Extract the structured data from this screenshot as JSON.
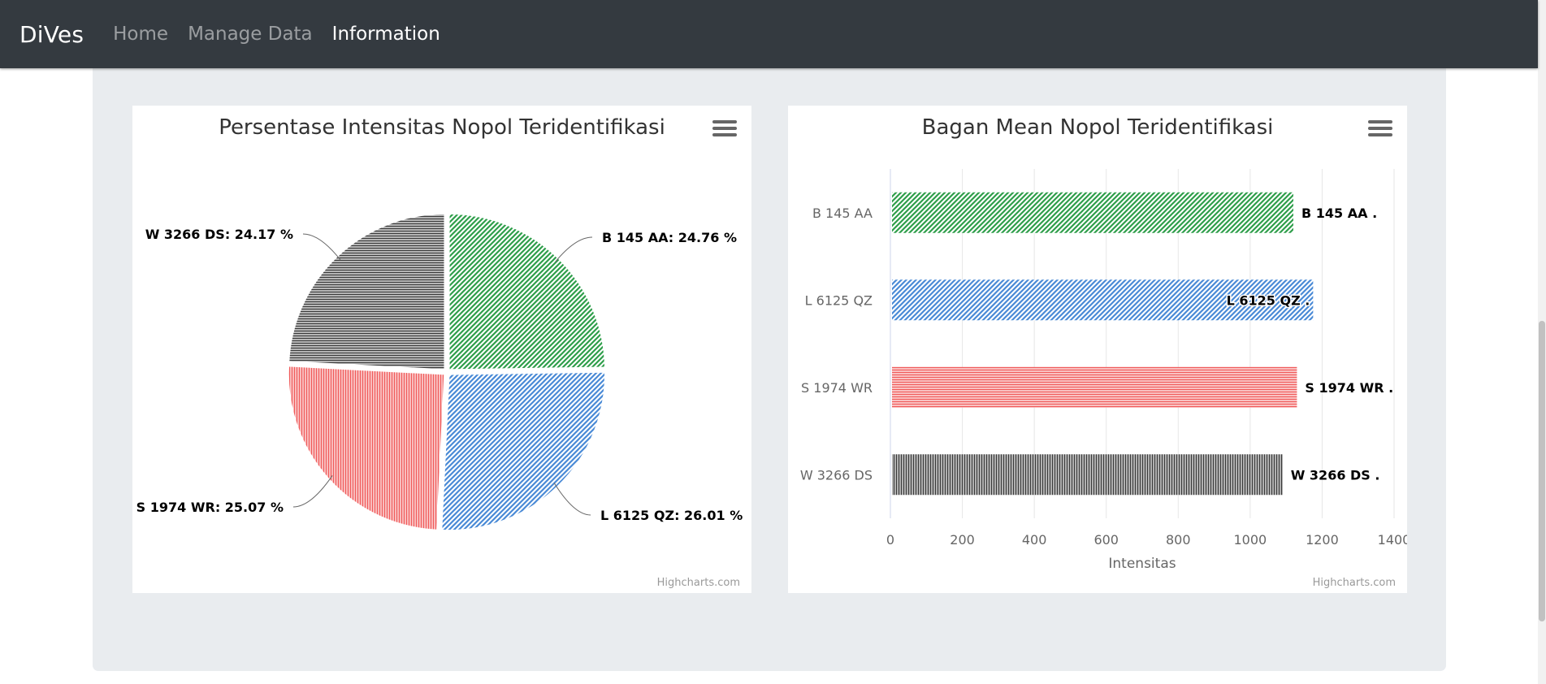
{
  "navbar": {
    "brand": "DiVes",
    "links": [
      {
        "label": "Home",
        "active": false
      },
      {
        "label": "Manage Data",
        "active": false
      },
      {
        "label": "Information",
        "active": true
      }
    ]
  },
  "credits": "Highcharts.com",
  "colors": {
    "green": "#2e9e4a",
    "blue": "#4a8ad6",
    "red": "#f05a5a",
    "black": "#3a3a3a"
  },
  "chart_data": [
    {
      "type": "pie",
      "title": "Persentase Intensitas Nopol Teridentifikasi",
      "slices": [
        {
          "name": "B 145 AA",
          "value": 24.76,
          "label": "B 145 AA: 24.76 %",
          "color": "#2e9e4a",
          "pattern": "diagonal"
        },
        {
          "name": "L 6125 QZ",
          "value": 26.01,
          "label": "L 6125 QZ: 26.01 %",
          "color": "#4a8ad6",
          "pattern": "diagonal"
        },
        {
          "name": "S 1974 WR",
          "value": 25.07,
          "label": "S 1974 WR: 25.07 %",
          "color": "#f05a5a",
          "pattern": "vertical"
        },
        {
          "name": "W 3266 DS",
          "value": 24.17,
          "label": "W 3266 DS: 24.17 %",
          "color": "#3a3a3a",
          "pattern": "horizontal"
        }
      ]
    },
    {
      "type": "bar",
      "title": "Bagan Mean Nopol Teridentifikasi",
      "categories": [
        "B 145 AA",
        "L 6125 QZ",
        "S 1974 WR",
        "W 3266 DS"
      ],
      "values": [
        1120,
        1175,
        1130,
        1090
      ],
      "data_labels": [
        "B 145 AA .",
        "L 6125 QZ .",
        "S 1974 WR .",
        "W 3266 DS ."
      ],
      "colors": [
        "#2e9e4a",
        "#4a8ad6",
        "#f05a5a",
        "#3a3a3a"
      ],
      "patterns": [
        "diagonal",
        "diagonal",
        "horizontal",
        "vertical"
      ],
      "xlabel": "Intensitas",
      "xlim": [
        0,
        1400
      ],
      "ticks": [
        0,
        200,
        400,
        600,
        800,
        1000,
        1200,
        1400
      ],
      "grid": true
    }
  ]
}
